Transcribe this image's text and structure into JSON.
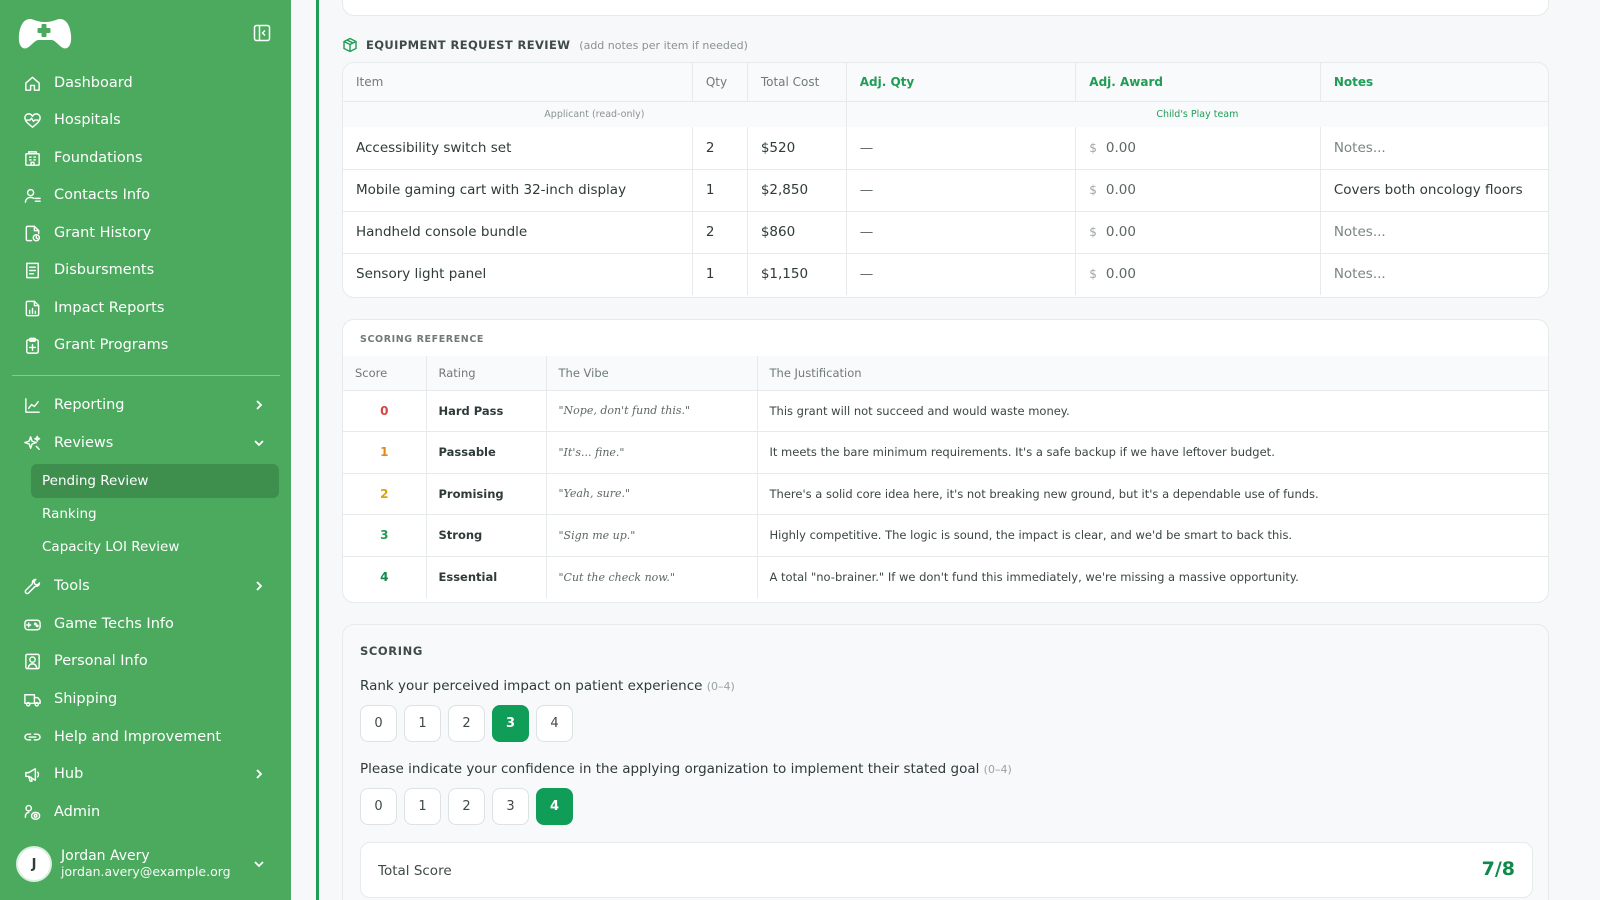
{
  "sidebar": {
    "nav": [
      {
        "label": "Dashboard",
        "icon": "home-icon"
      },
      {
        "label": "Hospitals",
        "icon": "heart-pulse-icon"
      },
      {
        "label": "Foundations",
        "icon": "building-icon"
      },
      {
        "label": "Contacts Info",
        "icon": "contacts-icon"
      },
      {
        "label": "Grant History",
        "icon": "file-history-icon"
      },
      {
        "label": "Disbursments",
        "icon": "receipt-icon"
      },
      {
        "label": "Impact Reports",
        "icon": "file-chart-icon"
      },
      {
        "label": "Grant Programs",
        "icon": "clipboard-plus-icon"
      }
    ],
    "nav2": [
      {
        "label": "Reporting",
        "icon": "line-chart-icon"
      },
      {
        "label": "Reviews",
        "icon": "sparkles-icon"
      }
    ],
    "reviews_sub": [
      "Pending Review",
      "Ranking",
      "Capacity LOI Review"
    ],
    "nav3": [
      {
        "label": "Tools",
        "icon": "wrench-icon"
      },
      {
        "label": "Game Techs Info",
        "icon": "gamepad-icon"
      },
      {
        "label": "Personal Info",
        "icon": "user-square-icon"
      },
      {
        "label": "Shipping",
        "icon": "truck-icon"
      },
      {
        "label": "Help and Improvement",
        "icon": "link-icon"
      },
      {
        "label": "Hub",
        "icon": "megaphone-icon"
      },
      {
        "label": "Admin",
        "icon": "admin-icon"
      }
    ],
    "user": {
      "initial": "J",
      "name": "Jordan Avery",
      "email": "jordan.avery@example.org"
    }
  },
  "equipment": {
    "title": "EQUIPMENT REQUEST REVIEW",
    "hint": "(add notes per item if needed)",
    "columns": [
      "Item",
      "Qty",
      "Total Cost",
      "Adj. Qty",
      "Adj. Award",
      "Notes"
    ],
    "group_applicant": "Applicant (read-only)",
    "group_team": "Child's Play team",
    "currency_symbol": "$",
    "rows": [
      {
        "item": "Accessibility switch set",
        "qty": "2",
        "cost": "$520",
        "adj_qty": "—",
        "award": "0.00",
        "notes": "Notes..."
      },
      {
        "item": "Mobile gaming cart with 32-inch display",
        "qty": "1",
        "cost": "$2,850",
        "adj_qty": "—",
        "award": "0.00",
        "notes": "Covers both oncology floors"
      },
      {
        "item": "Handheld console bundle",
        "qty": "2",
        "cost": "$860",
        "adj_qty": "—",
        "award": "0.00",
        "notes": "Notes..."
      },
      {
        "item": "Sensory light panel",
        "qty": "1",
        "cost": "$1,150",
        "adj_qty": "—",
        "award": "0.00",
        "notes": "Notes..."
      }
    ]
  },
  "scoring_reference": {
    "title": "SCORING REFERENCE",
    "columns": [
      "Score",
      "Rating",
      "The Vibe",
      "The Justification"
    ],
    "rows": [
      {
        "score": "0",
        "rating": "Hard Pass",
        "vibe": "\"Nope, don't fund this.\"",
        "justification": "This grant will not succeed and would waste money.",
        "color": "#d64545"
      },
      {
        "score": "1",
        "rating": "Passable",
        "vibe": "\"It's... fine.\"",
        "justification": "It meets the bare minimum requirements. It's a safe backup if we have leftover budget.",
        "color": "#e08a1e"
      },
      {
        "score": "2",
        "rating": "Promising",
        "vibe": "\"Yeah, sure.\"",
        "justification": "There's a solid core idea here, it's not breaking new ground, but it's a dependable use of funds.",
        "color": "#d9a20f"
      },
      {
        "score": "3",
        "rating": "Strong",
        "vibe": "\"Sign me up.\"",
        "justification": "Highly competitive. The logic is sound, the impact is clear, and we'd be smart to back this.",
        "color": "#1f9d55"
      },
      {
        "score": "4",
        "rating": "Essential",
        "vibe": "\"Cut the check now.\"",
        "justification": "A total \"no-brainer.\" If we don't fund this immediately, we're missing a massive opportunity.",
        "color": "#0f8a4c"
      }
    ]
  },
  "scoring": {
    "title": "SCORING",
    "q1": {
      "label": "Rank your perceived impact on patient experience",
      "range": "(0–4)",
      "options": [
        "0",
        "1",
        "2",
        "3",
        "4"
      ],
      "selected": "3"
    },
    "q2": {
      "label": "Please indicate your confidence in the applying organization to implement their stated goal",
      "range": "(0–4)",
      "options": [
        "0",
        "1",
        "2",
        "3",
        "4"
      ],
      "selected": "4"
    },
    "total_label": "Total Score",
    "total_value": "7/8"
  }
}
